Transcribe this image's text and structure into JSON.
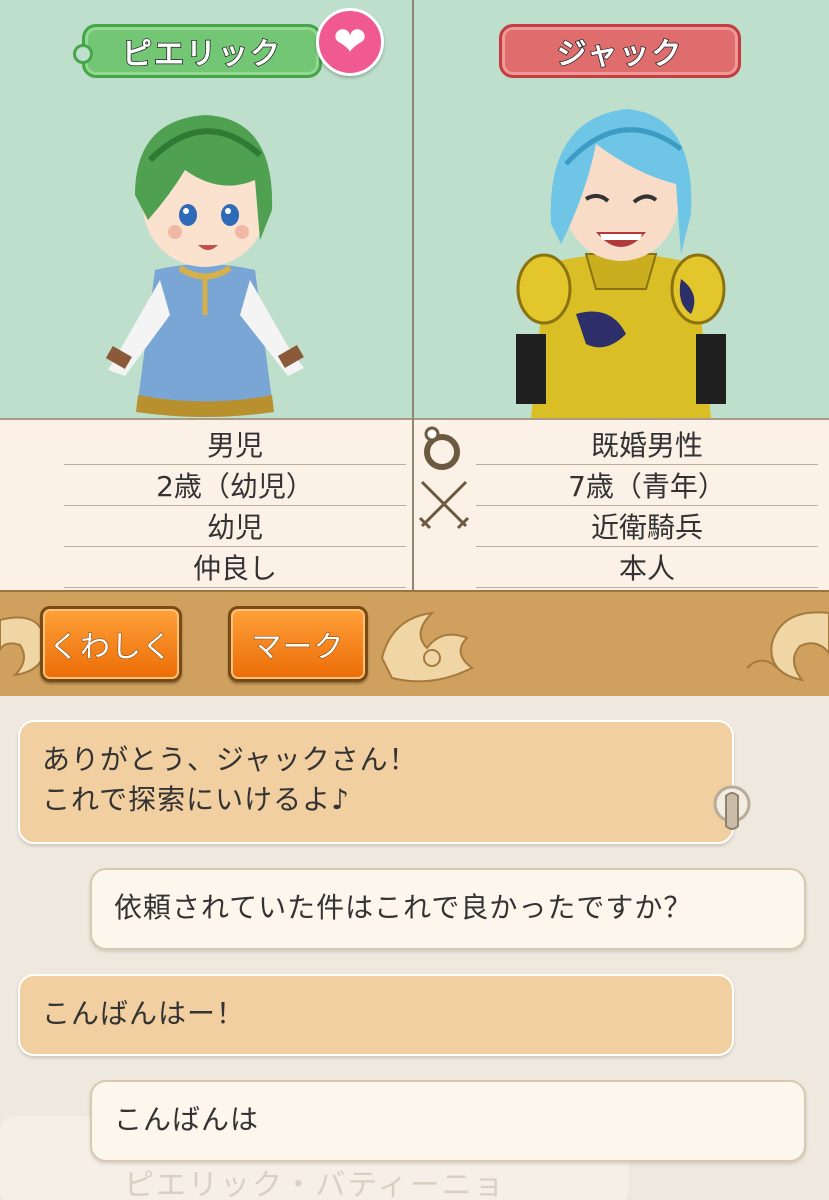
{
  "left_character": {
    "name": "ピエリック",
    "info": [
      "男児",
      "2歳（幼児）",
      "幼児",
      "仲良し"
    ]
  },
  "right_character": {
    "name": "ジャック",
    "info": [
      "既婚男性",
      "7歳（青年）",
      "近衛騎兵",
      "本人"
    ]
  },
  "buttons": {
    "detail": "くわしく",
    "mark": "マーク"
  },
  "chat": {
    "messages": [
      {
        "from": "other",
        "line1": "ありがとう、ジャックさん！",
        "line2": "これで探索にいけるよ♪"
      },
      {
        "from": "self",
        "line1": "依頼されていた件はこれで良かったですか？"
      },
      {
        "from": "other",
        "line1": "こんばんはー！"
      },
      {
        "from": "self",
        "line1": "こんばんは"
      }
    ],
    "background_name": "ピエリック・バティーニョ"
  },
  "colors": {
    "panel_bg": "#bfdfcd",
    "left_tag": "#73c774",
    "right_tag": "#e06d6d",
    "heart": "#f05a90",
    "button": "#f08a1e",
    "bar": "#d0a05e"
  }
}
